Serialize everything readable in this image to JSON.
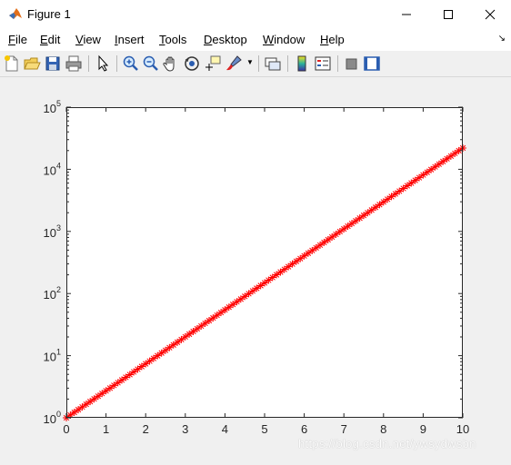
{
  "window": {
    "title": "Figure 1"
  },
  "menu": [
    {
      "key": "F",
      "rest": "ile"
    },
    {
      "key": "E",
      "rest": "dit"
    },
    {
      "key": "V",
      "rest": "iew"
    },
    {
      "key": "I",
      "rest": "nsert"
    },
    {
      "key": "T",
      "rest": "ools"
    },
    {
      "key": "D",
      "rest": "esktop"
    },
    {
      "key": "W",
      "rest": "indow"
    },
    {
      "key": "H",
      "rest": "elp"
    }
  ],
  "toolbar": {
    "icons": [
      "new-figure-icon",
      "open-file-icon",
      "save-icon",
      "print-icon",
      "pointer-icon",
      "zoom-in-icon",
      "zoom-out-icon",
      "pan-icon",
      "rotate-3d-icon",
      "data-cursor-icon",
      "brush-icon",
      "link-plot-icon",
      "insert-colorbar-icon",
      "insert-legend-icon",
      "hide-plot-tools-icon",
      "show-plot-tools-icon"
    ]
  },
  "chart_data": {
    "type": "line",
    "title": "",
    "xlabel": "",
    "ylabel": "",
    "xlim": [
      0,
      10
    ],
    "ylim": [
      1,
      100000
    ],
    "yscale": "log",
    "xticks": [
      "0",
      "1",
      "2",
      "3",
      "4",
      "5",
      "6",
      "6",
      "7",
      "8",
      "9",
      "10"
    ],
    "xtick_values": [
      0,
      1,
      2,
      3,
      4,
      5,
      6,
      7,
      8,
      9,
      10
    ],
    "xtick_labels": [
      "0",
      "1",
      "2",
      "3",
      "4",
      "5",
      "6",
      "7",
      "8",
      "9",
      "10"
    ],
    "ytick_values": [
      1,
      10,
      100,
      1000,
      10000,
      100000
    ],
    "ytick_labels": [
      {
        "base": "10",
        "exp": "0"
      },
      {
        "base": "10",
        "exp": "1"
      },
      {
        "base": "10",
        "exp": "2"
      },
      {
        "base": "10",
        "exp": "3"
      },
      {
        "base": "10",
        "exp": "4"
      },
      {
        "base": "10",
        "exp": "5"
      }
    ],
    "grid": false,
    "series": [
      {
        "marker": "*",
        "color": "#ff0000",
        "function": "y = exp(x)",
        "x_start": 0,
        "x_end": 10,
        "x_step": 0.1,
        "y_start": 1,
        "y_end": 22026
      }
    ]
  },
  "watermark": "https://blog.csdn.net/ywsydwsbn"
}
